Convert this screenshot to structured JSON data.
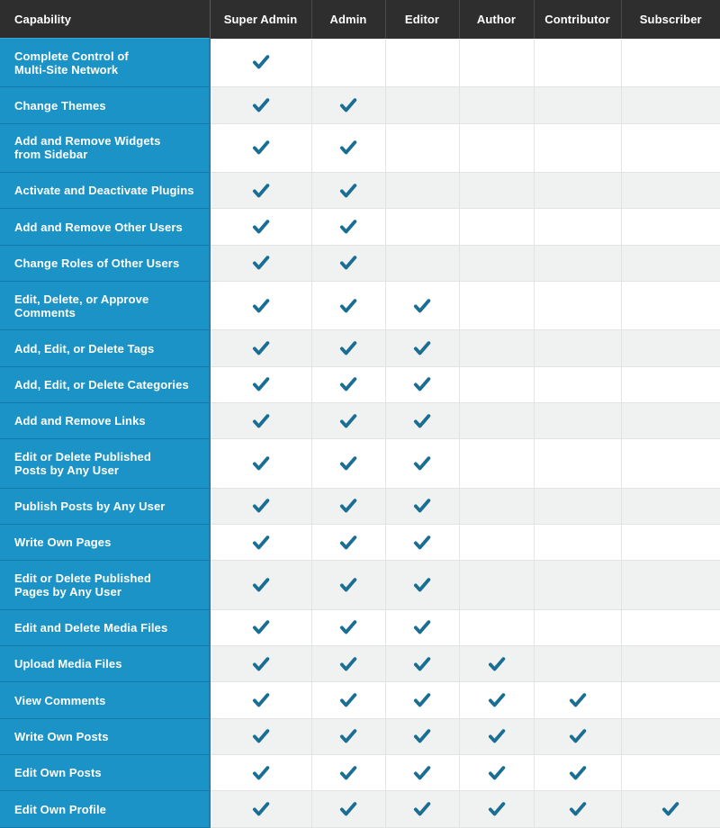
{
  "table": {
    "columns": [
      {
        "key": "capability",
        "label": "Capability"
      },
      {
        "key": "super_admin",
        "label": "Super Admin"
      },
      {
        "key": "admin",
        "label": "Admin"
      },
      {
        "key": "editor",
        "label": "Editor"
      },
      {
        "key": "author",
        "label": "Author"
      },
      {
        "key": "contributor",
        "label": "Contributor"
      },
      {
        "key": "subscriber",
        "label": "Subscriber"
      }
    ],
    "check_mark_glyph": "check-icon",
    "colors": {
      "header_background": "#2e2e2e",
      "header_text": "#ffffff",
      "capability_background": "#1b93c6",
      "capability_text": "#ffffff",
      "check_mark": "#1a6e94",
      "row_odd_background": "#ffffff",
      "row_even_background": "#f0f1f1",
      "grid_line": "#e2e4e4"
    },
    "rows": [
      {
        "capability": "Complete Control of Multi-Site Network",
        "lines": [
          "Complete Control of",
          "Multi-Site Network"
        ],
        "checks": [
          true,
          false,
          false,
          false,
          false,
          false
        ]
      },
      {
        "capability": "Change Themes",
        "lines": [
          "Change Themes"
        ],
        "checks": [
          true,
          true,
          false,
          false,
          false,
          false
        ]
      },
      {
        "capability": "Add and Remove Widgets from Sidebar",
        "lines": [
          "Add and Remove Widgets",
          "from Sidebar"
        ],
        "checks": [
          true,
          true,
          false,
          false,
          false,
          false
        ]
      },
      {
        "capability": "Activate and Deactivate Plugins",
        "lines": [
          "Activate and Deactivate Plugins"
        ],
        "checks": [
          true,
          true,
          false,
          false,
          false,
          false
        ]
      },
      {
        "capability": "Add and Remove Other Users",
        "lines": [
          "Add and Remove Other Users"
        ],
        "checks": [
          true,
          true,
          false,
          false,
          false,
          false
        ]
      },
      {
        "capability": "Change Roles of Other Users",
        "lines": [
          "Change Roles of Other Users"
        ],
        "checks": [
          true,
          true,
          false,
          false,
          false,
          false
        ]
      },
      {
        "capability": "Edit, Delete, or Approve Comments",
        "lines": [
          "Edit, Delete, or Approve",
          "Comments"
        ],
        "checks": [
          true,
          true,
          true,
          false,
          false,
          false
        ]
      },
      {
        "capability": "Add, Edit, or Delete Tags",
        "lines": [
          "Add, Edit, or Delete Tags"
        ],
        "checks": [
          true,
          true,
          true,
          false,
          false,
          false
        ]
      },
      {
        "capability": "Add, Edit, or Delete Categories",
        "lines": [
          "Add, Edit, or Delete Categories"
        ],
        "checks": [
          true,
          true,
          true,
          false,
          false,
          false
        ]
      },
      {
        "capability": "Add and Remove Links",
        "lines": [
          "Add and Remove Links"
        ],
        "checks": [
          true,
          true,
          true,
          false,
          false,
          false
        ]
      },
      {
        "capability": "Edit or Delete Published Posts by Any User",
        "lines": [
          "Edit or Delete Published",
          "Posts by Any User"
        ],
        "checks": [
          true,
          true,
          true,
          false,
          false,
          false
        ]
      },
      {
        "capability": "Publish Posts by Any User",
        "lines": [
          "Publish Posts by Any User"
        ],
        "checks": [
          true,
          true,
          true,
          false,
          false,
          false
        ]
      },
      {
        "capability": "Write Own Pages",
        "lines": [
          "Write Own Pages"
        ],
        "checks": [
          true,
          true,
          true,
          false,
          false,
          false
        ]
      },
      {
        "capability": "Edit or Delete Published Pages by Any User",
        "lines": [
          "Edit or Delete Published",
          "Pages by Any User"
        ],
        "checks": [
          true,
          true,
          true,
          false,
          false,
          false
        ]
      },
      {
        "capability": "Edit and Delete Media Files",
        "lines": [
          "Edit and Delete Media Files"
        ],
        "checks": [
          true,
          true,
          true,
          false,
          false,
          false
        ]
      },
      {
        "capability": "Upload Media Files",
        "lines": [
          "Upload Media Files"
        ],
        "checks": [
          true,
          true,
          true,
          true,
          false,
          false
        ]
      },
      {
        "capability": "View Comments",
        "lines": [
          "View Comments"
        ],
        "checks": [
          true,
          true,
          true,
          true,
          true,
          false
        ]
      },
      {
        "capability": "Write Own Posts",
        "lines": [
          "Write Own Posts"
        ],
        "checks": [
          true,
          true,
          true,
          true,
          true,
          false
        ]
      },
      {
        "capability": "Edit Own Posts",
        "lines": [
          "Edit Own Posts"
        ],
        "checks": [
          true,
          true,
          true,
          true,
          true,
          false
        ]
      },
      {
        "capability": "Edit Own Profile",
        "lines": [
          "Edit Own Profile"
        ],
        "checks": [
          true,
          true,
          true,
          true,
          true,
          true
        ]
      }
    ]
  }
}
